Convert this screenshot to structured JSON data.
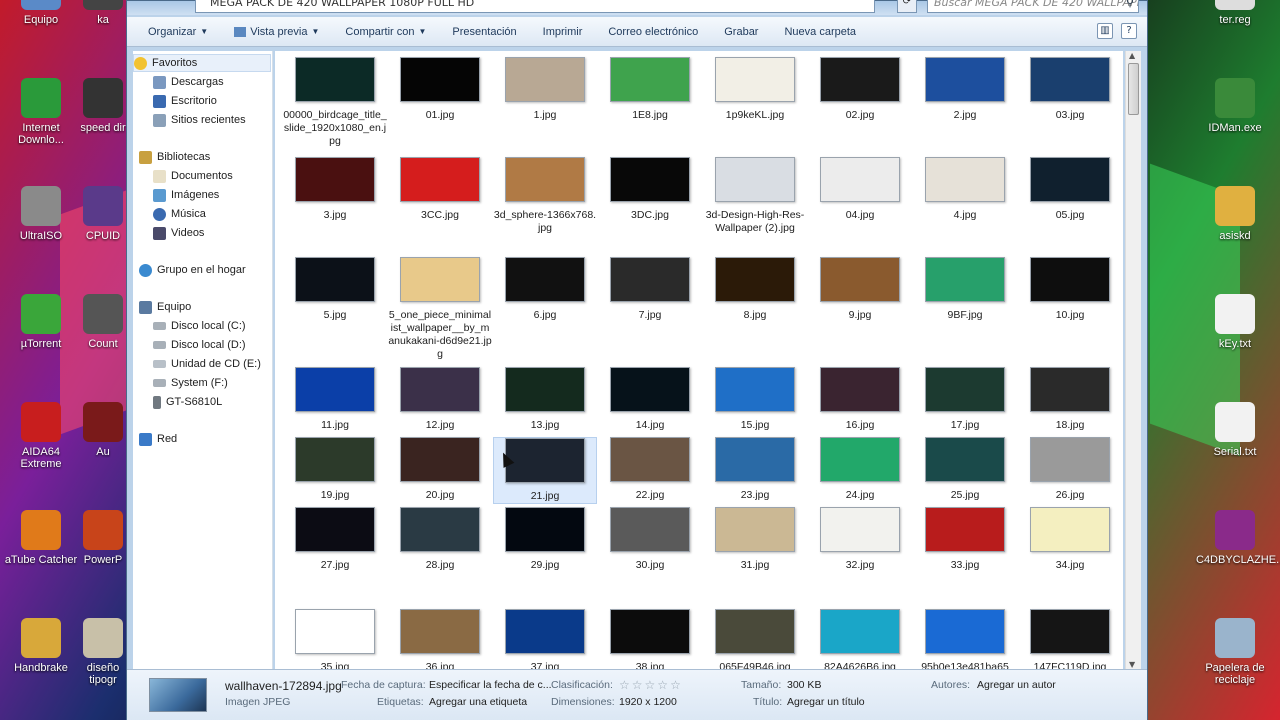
{
  "address": "MEGA PACK DE 420 WALLPAPER 1080P FULL HD",
  "search_placeholder": "Buscar MEGA PACK DE 420 WALLPAPER ...",
  "toolbar": [
    "Organizar",
    "Vista previa",
    "Compartir con",
    "Presentación",
    "Imprimir",
    "Correo electrónico",
    "Grabar",
    "Nueva carpeta"
  ],
  "nav": {
    "favoritos": "Favoritos",
    "descargas": "Descargas",
    "escritorio": "Escritorio",
    "sitios": "Sitios recientes",
    "bibliotecas": "Bibliotecas",
    "documentos": "Documentos",
    "imagenes": "Imágenes",
    "musica": "Música",
    "videos": "Videos",
    "grupo": "Grupo en el hogar",
    "equipo": "Equipo",
    "disco_c": "Disco local (C:)",
    "disco_d": "Disco local (D:)",
    "cd_e": "Unidad de CD (E:)",
    "system_f": "System (F:)",
    "gt": "GT-S6810L",
    "red": "Red"
  },
  "files": [
    {
      "name": "00000_birdcage_title_slide_1920x1080_en.jpg",
      "color": "#0c2a26"
    },
    {
      "name": "01.jpg",
      "color": "#050505"
    },
    {
      "name": "1.jpg",
      "color": "#b8a894"
    },
    {
      "name": "1E8.jpg",
      "color": "#3fa34d"
    },
    {
      "name": "1p9keKL.jpg",
      "color": "#f2efe6"
    },
    {
      "name": "02.jpg",
      "color": "#1a1a1a"
    },
    {
      "name": "2.jpg",
      "color": "#1d4f9e"
    },
    {
      "name": "03.jpg",
      "color": "#1a3f6e"
    },
    {
      "name": "3.jpg",
      "color": "#4a1010"
    },
    {
      "name": "3CC.jpg",
      "color": "#d51d1d"
    },
    {
      "name": "3d_sphere-1366x768.jpg",
      "color": "#b07a45"
    },
    {
      "name": "3DC.jpg",
      "color": "#080808"
    },
    {
      "name": "3d-Design-High-Res-Wallpaper (2).jpg",
      "color": "#d9dde3"
    },
    {
      "name": "04.jpg",
      "color": "#ececec"
    },
    {
      "name": "4.jpg",
      "color": "#e6e1d8"
    },
    {
      "name": "05.jpg",
      "color": "#10202e"
    },
    {
      "name": "5.jpg",
      "color": "#0c1118"
    },
    {
      "name": "5_one_piece_minimalist_wallpaper__by_manukakani-d6d9e21.jpg",
      "color": "#e8c98a"
    },
    {
      "name": "6.jpg",
      "color": "#111111"
    },
    {
      "name": "7.jpg",
      "color": "#2a2a2a"
    },
    {
      "name": "8.jpg",
      "color": "#2b1a08"
    },
    {
      "name": "9.jpg",
      "color": "#8a5a2e"
    },
    {
      "name": "9BF.jpg",
      "color": "#27a06b"
    },
    {
      "name": "10.jpg",
      "color": "#0e0e0e"
    },
    {
      "name": "11.jpg",
      "color": "#0b3fa8"
    },
    {
      "name": "12.jpg",
      "color": "#3b3049"
    },
    {
      "name": "13.jpg",
      "color": "#142a1e"
    },
    {
      "name": "14.jpg",
      "color": "#06121a"
    },
    {
      "name": "15.jpg",
      "color": "#1f6fc7"
    },
    {
      "name": "16.jpg",
      "color": "#3a2430"
    },
    {
      "name": "17.jpg",
      "color": "#1c3a30"
    },
    {
      "name": "18.jpg",
      "color": "#2a2a2a"
    },
    {
      "name": "19.jpg",
      "color": "#2c3a2a"
    },
    {
      "name": "20.jpg",
      "color": "#3a2420"
    },
    {
      "name": "21.jpg",
      "color": "#1c2430"
    },
    {
      "name": "22.jpg",
      "color": "#6a5544"
    },
    {
      "name": "23.jpg",
      "color": "#2a6aa6"
    },
    {
      "name": "24.jpg",
      "color": "#22a86a"
    },
    {
      "name": "25.jpg",
      "color": "#1a4a4a"
    },
    {
      "name": "26.jpg",
      "color": "#9a9a9a"
    },
    {
      "name": "27.jpg",
      "color": "#0c0c14"
    },
    {
      "name": "28.jpg",
      "color": "#2a3a44"
    },
    {
      "name": "29.jpg",
      "color": "#030810"
    },
    {
      "name": "30.jpg",
      "color": "#5a5a5a"
    },
    {
      "name": "31.jpg",
      "color": "#cbb894"
    },
    {
      "name": "32.jpg",
      "color": "#f2f2ee"
    },
    {
      "name": "33.jpg",
      "color": "#b81c1c"
    },
    {
      "name": "34.jpg",
      "color": "#f4efc0"
    },
    {
      "name": "35.jpg",
      "color": "#ffffff"
    },
    {
      "name": "36.jpg",
      "color": "#8a6a44"
    },
    {
      "name": "37.jpg",
      "color": "#0a3a8a"
    },
    {
      "name": "38.jpg",
      "color": "#0c0c0c"
    },
    {
      "name": "065F49B46.jpg",
      "color": "#4a4a3a"
    },
    {
      "name": "82A4626B6.jpg",
      "color": "#1aa6c8"
    },
    {
      "name": "95b0e13e481ba65",
      "color": "#1a6ad4"
    },
    {
      "name": "147FC119D.jpg",
      "color": "#151515"
    }
  ],
  "details": {
    "filename": "wallhaven-172894.jpg",
    "filetype": "Imagen JPEG",
    "fecha_label": "Fecha de captura:",
    "fecha_value": "Especificar la fecha de c...",
    "etiquetas_label": "Etiquetas:",
    "etiquetas_value": "Agregar una etiqueta",
    "clasificacion_label": "Clasificación:",
    "dimensiones_label": "Dimensiones:",
    "dimensiones_value": "1920 x 1200",
    "tamano_label": "Tamaño:",
    "tamano_value": "300 KB",
    "titulo_label": "Título:",
    "titulo_value": "Agregar un título",
    "autores_label": "Autores:",
    "autores_value": "Agregar un autor",
    "rating": 0
  },
  "desktop_left": [
    {
      "label": "Equipo",
      "color": "#5a8ac8"
    },
    {
      "label": "Internet Downlo...",
      "color": "#2a9a3a"
    },
    {
      "label": "UltraISO",
      "color": "#8a8a8a"
    },
    {
      "label": "µTorrent",
      "color": "#3aa63a"
    },
    {
      "label": "AIDA64 Extreme",
      "color": "#c81e1e"
    },
    {
      "label": "aTube Catcher",
      "color": "#e07a1a"
    },
    {
      "label": "Handbrake",
      "color": "#d8a83a"
    }
  ],
  "desktop_left2": [
    {
      "label": "ka",
      "color": "#444"
    },
    {
      "label": "speed dir",
      "color": "#333"
    },
    {
      "label": "CPUID",
      "color": "#5a3a8a"
    },
    {
      "label": "Count",
      "color": "#555"
    },
    {
      "label": "Au",
      "color": "#7a1a1a"
    },
    {
      "label": "PowerP",
      "color": "#c8441a"
    },
    {
      "label": "diseño tipogr",
      "color": "#c8c0a8"
    }
  ],
  "desktop_right": [
    {
      "label": "ter.reg",
      "color": "#ddd"
    },
    {
      "label": "IDMan.exe",
      "color": "#3a8a3a"
    },
    {
      "label": "asiskd",
      "color": "#e0b040"
    },
    {
      "label": "kEy.txt",
      "color": "#f2f2f2"
    },
    {
      "label": "Serial.txt",
      "color": "#f2f2f2"
    },
    {
      "label": "C4DBYCLAZHE...",
      "color": "#8a2a8a"
    },
    {
      "label": "Papelera de reciclaje",
      "color": "#9ab4cc"
    }
  ]
}
